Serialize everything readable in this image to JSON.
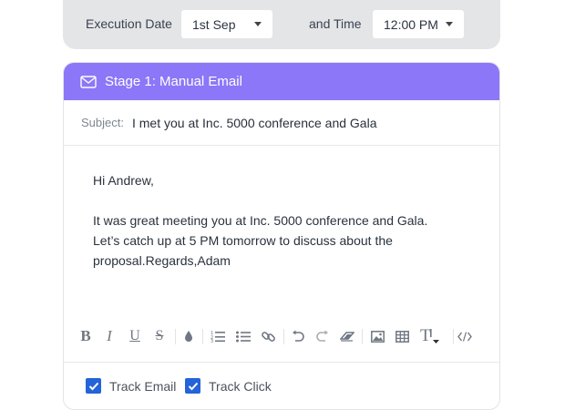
{
  "schedule": {
    "date_label": "Execution Date",
    "date_value": "1st Sep",
    "time_label": "and Time",
    "time_value": "12:00 PM"
  },
  "stage": {
    "title": "Stage 1: Manual Email",
    "subject_label": "Subject:",
    "subject_value": "I met you at Inc. 5000 conference and Gala",
    "body": {
      "greeting": "Hi Andrew,",
      "line1": "It was great meeting you at Inc. 5000 conference and Gala.",
      "line2": "Let’s catch up at 5 PM tomorrow to discuss about the",
      "line3": "proposal.Regards,Adam"
    }
  },
  "toolbar": {
    "bold": "B",
    "italic": "I",
    "underline": "U",
    "strike": "S",
    "font_size": "T"
  },
  "icons": [
    "mail-icon",
    "ink-drop-icon",
    "ordered-list-icon",
    "bullet-list-icon",
    "link-icon",
    "undo-icon",
    "redo-icon",
    "eraser-icon",
    "image-icon",
    "table-icon",
    "text-size-icon",
    "code-icon",
    "check-icon"
  ],
  "tracking": {
    "track_email": "Track Email",
    "track_click": "Track Click"
  },
  "colors": {
    "header": "#8b77f8",
    "checkbox": "#2463d8",
    "schedule_bg": "#e4e5e7"
  }
}
